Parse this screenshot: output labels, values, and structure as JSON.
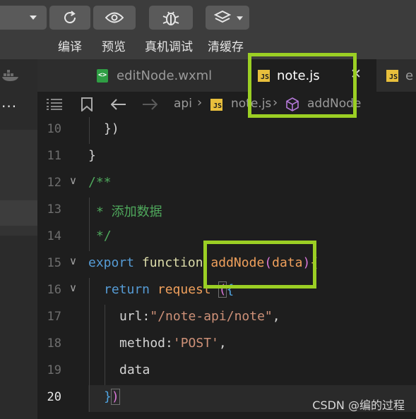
{
  "toolbar": {
    "buttons": [
      {
        "label": "编译",
        "icon": "compile-icon"
      },
      {
        "label": "预览",
        "icon": "eye-icon"
      },
      {
        "label": "真机调试",
        "icon": "bug-icon"
      },
      {
        "label": "清缓存",
        "icon": "layers-icon"
      }
    ]
  },
  "tabs": [
    {
      "label": "editNode.wxml",
      "type": "wxml"
    },
    {
      "label": "note.js",
      "type": "js",
      "active": true
    },
    {
      "label": "e",
      "type": "js"
    }
  ],
  "breadcrumb": [
    "api",
    "note.js",
    "addNode"
  ],
  "editor": {
    "current_line": 20,
    "lines": [
      {
        "num": "10",
        "text": "})"
      },
      {
        "num": "11",
        "text": "}"
      },
      {
        "num": "12",
        "text": "/**"
      },
      {
        "num": "13",
        "text": "* 添加数据"
      },
      {
        "num": "14",
        "text": "*/"
      },
      {
        "num": "15",
        "text": "export function addNode(data){"
      },
      {
        "num": "16",
        "text": "return request ({"
      },
      {
        "num": "17",
        "text": "url:\"/note-api/note\","
      },
      {
        "num": "18",
        "text": "method:'POST',"
      },
      {
        "num": "19",
        "text": "data"
      },
      {
        "num": "20",
        "text": "})"
      }
    ],
    "tokens": {
      "l10": "})",
      "l11": "}",
      "l12": "/**",
      "l13": "* 添加数据",
      "l14": "*/",
      "l15_kw1": "export",
      "l15_kw2": "function",
      "l15_name": "addNode",
      "l15_p1": "(",
      "l15_param": "data",
      "l15_p2": ")",
      "l15_brace": "{",
      "l16_kw": "return",
      "l16_fn": "request",
      "l16_paren": "(",
      "l16_brace": "{",
      "l17_key": "url:",
      "l17_val": "\"/note-api/note\"",
      "l17_comma": ",",
      "l18_key": "method:",
      "l18_val": "'POST'",
      "l18_comma": ",",
      "l19": "data",
      "l20_brace": "}",
      "l20_paren": ")"
    }
  },
  "watermark": "CSDN @编的过程",
  "colors": {
    "highlight": "#9bcf24",
    "js_badge": "#e8bf3c",
    "keyword": "#569cd6",
    "string": "#ce9178",
    "comment": "#4fa85c"
  }
}
